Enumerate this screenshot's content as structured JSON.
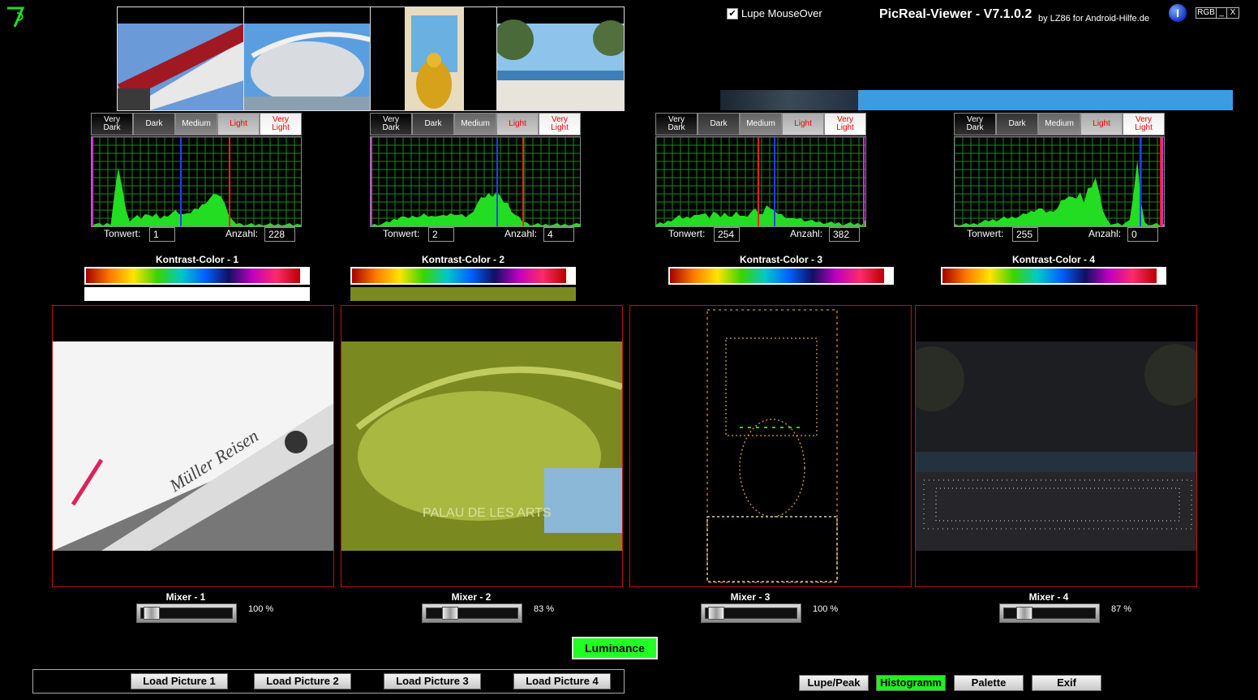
{
  "app": {
    "title": "PicReal-Viewer - V7.1.0.2",
    "subtitle": "by LZ86 for Android-Hilfe.de",
    "lupe_mouseover_label": "Lupe MouseOver",
    "lupe_mouseover_checked": true,
    "win_rgb": "RGB",
    "win_min": "_",
    "win_close": "X"
  },
  "tone_buttons": [
    "Very Dark",
    "Dark",
    "Medium",
    "Light",
    "Very Light"
  ],
  "histograms": [
    {
      "tonwert_label": "Tonwert:",
      "tonwert": "1",
      "anzahl_label": "Anzahl:",
      "anzahl": "228"
    },
    {
      "tonwert_label": "Tonwert:",
      "tonwert": "2",
      "anzahl_label": "Anzahl:",
      "anzahl": "4"
    },
    {
      "tonwert_label": "Tonwert:",
      "tonwert": "254",
      "anzahl_label": "Anzahl:",
      "anzahl": "382"
    },
    {
      "tonwert_label": "Tonwert:",
      "tonwert": "255",
      "anzahl_label": "Anzahl:",
      "anzahl": "0"
    }
  ],
  "kontrast": [
    {
      "label": "Kontrast-Color - 1",
      "swatch": "#ffffff"
    },
    {
      "label": "Kontrast-Color - 2",
      "swatch": "#7a8a20"
    },
    {
      "label": "Kontrast-Color - 3",
      "swatch": ""
    },
    {
      "label": "Kontrast-Color - 4",
      "swatch": ""
    }
  ],
  "mixers": [
    {
      "label": "Mixer - 1",
      "value_text": "100 %",
      "value": 100
    },
    {
      "label": "Mixer - 2",
      "value_text": "83 %",
      "value": 83
    },
    {
      "label": "Mixer - 3",
      "value_text": "100 %",
      "value": 100
    },
    {
      "label": "Mixer - 4",
      "value_text": "87 %",
      "value": 87
    }
  ],
  "luminance_label": "Luminance",
  "load_buttons": [
    "Load Picture 1",
    "Load Picture 2",
    "Load Picture 3",
    "Load Picture 4"
  ],
  "bottom_buttons": {
    "lupe_peak": "Lupe/Peak",
    "histogramm": "Histogramm",
    "palette": "Palette",
    "exif": "Exif"
  },
  "colors": {
    "accent_green": "#22ff22",
    "panel_border": "#c01010",
    "hist_grid": "#1a8a1a"
  }
}
